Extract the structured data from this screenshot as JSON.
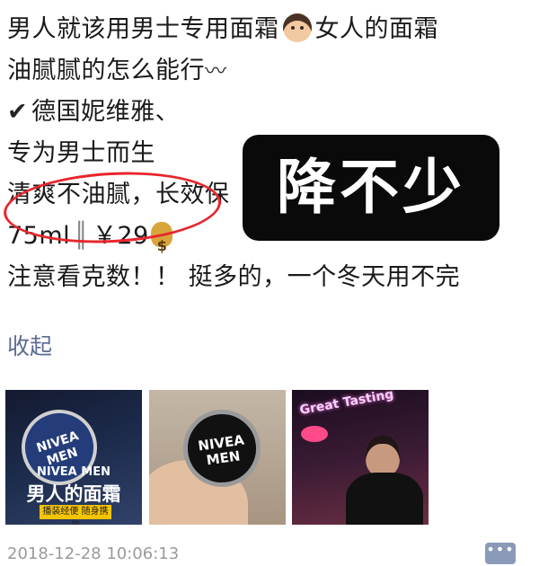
{
  "post": {
    "lines": [
      "男人就该用男士专用面霜",
      "女人的面霜",
      "油腻腻的怎么能行",
      "〰",
      "✔",
      "德国妮维雅、",
      "专为男士而生",
      "清爽不油腻，长效保",
      "75ml",
      "║",
      "￥29",
      "注意看克数！！ 挺多的，一个冬天用不完"
    ],
    "overlay_label": "降不少",
    "collapse_label": "收起"
  },
  "thumbnails": {
    "t1": {
      "tin_text": "NIVEA MEN",
      "title": "NIVEA MEN",
      "headline": "男人的面霜",
      "tag": "播装经便 随身携带"
    },
    "t2": {
      "tin_text": "NIVEA MEN"
    },
    "t3": {
      "neon_text": "Great Tasting"
    }
  },
  "footer": {
    "timestamp": "2018-12-28 10:06:13",
    "more_glyph": "•••"
  },
  "icons": {
    "face": "man-face-emoji-icon",
    "money": "money-bag-emoji-icon",
    "check": "check-mark-icon"
  },
  "colors": {
    "link": "#5b6b93",
    "circle": "#e8262d",
    "overlay_bg": "#0a0a0a"
  }
}
